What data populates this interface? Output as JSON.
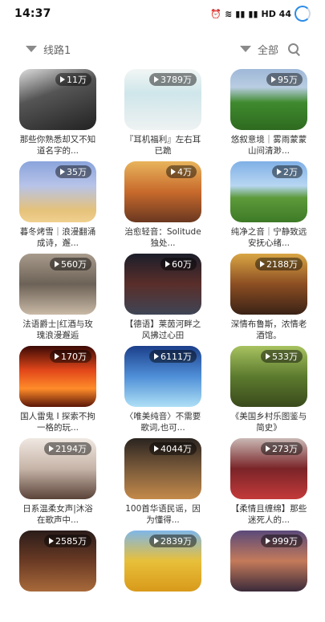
{
  "status_bar": {
    "time": "14:37",
    "icons_text": "HD 44"
  },
  "filters": {
    "left_label": "线路1",
    "right_label": "全部"
  },
  "cards": [
    {
      "count": "11万",
      "title": "那些你熟悉却又不知道名字的..."
    },
    {
      "count": "3789万",
      "title": "『耳机福利』左右耳已跪"
    },
    {
      "count": "95万",
      "title": "悠叙意境｜雾雨蒙蒙 山间清渺..."
    },
    {
      "count": "35万",
      "title": "暮冬烤雪｜浪漫翻涌成诗，邂..."
    },
    {
      "count": "4万",
      "title": "治愈轻音：Solitude独处..."
    },
    {
      "count": "2万",
      "title": "纯净之音｜宁静致远 安抚心绪..."
    },
    {
      "count": "560万",
      "title": "法语爵士|红酒与玫瑰浪漫邂逅"
    },
    {
      "count": "60万",
      "title": "【德语】莱茵河畔之风拂过心田"
    },
    {
      "count": "2188万",
      "title": "深情布鲁斯，浓情老酒馆。"
    },
    {
      "count": "170万",
      "title": "国人雷鬼 I 探索不拘一格的玩..."
    },
    {
      "count": "6111万",
      "title": "〈唯美纯音〉不需要歌词,也可..."
    },
    {
      "count": "533万",
      "title": "《美国乡村乐图鉴与简史》"
    },
    {
      "count": "2194万",
      "title": "日系温柔女声|沐浴在歌声中..."
    },
    {
      "count": "4044万",
      "title": "100首华语民谣，因为懂得..."
    },
    {
      "count": "273万",
      "title": "【柔情且缠绵】那些迷死人的..."
    },
    {
      "count": "2585万",
      "title": ""
    },
    {
      "count": "2839万",
      "title": ""
    },
    {
      "count": "999万",
      "title": ""
    }
  ]
}
